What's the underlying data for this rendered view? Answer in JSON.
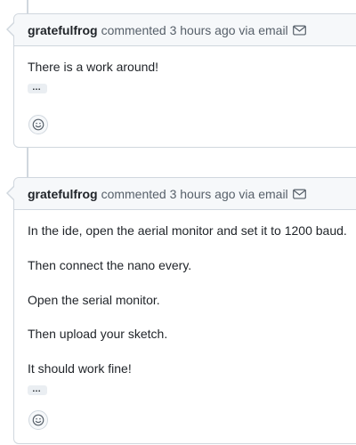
{
  "comments": [
    {
      "author": "gratefulfrog",
      "meta": "commented 3 hours ago via email",
      "body": [
        "There is a work around!"
      ],
      "icons": {
        "via": "mail-icon",
        "more": "ellipsis-icon",
        "react": "smiley-icon"
      }
    },
    {
      "author": "gratefulfrog",
      "meta": "commented 3 hours ago via email",
      "body": [
        "In the ide, open the aerial monitor and set it to 1200 baud.",
        "Then connect the nano every.",
        "Open the serial monitor.",
        "Then upload your sketch.",
        "It should work fine!"
      ],
      "icons": {
        "via": "mail-icon",
        "more": "ellipsis-icon",
        "react": "smiley-icon"
      }
    }
  ],
  "ellipsis_text": "…",
  "colors": {
    "border": "#d0d7de",
    "header_bg": "#f6f8fa",
    "muted_text": "#57606a",
    "text": "#1f2328"
  }
}
